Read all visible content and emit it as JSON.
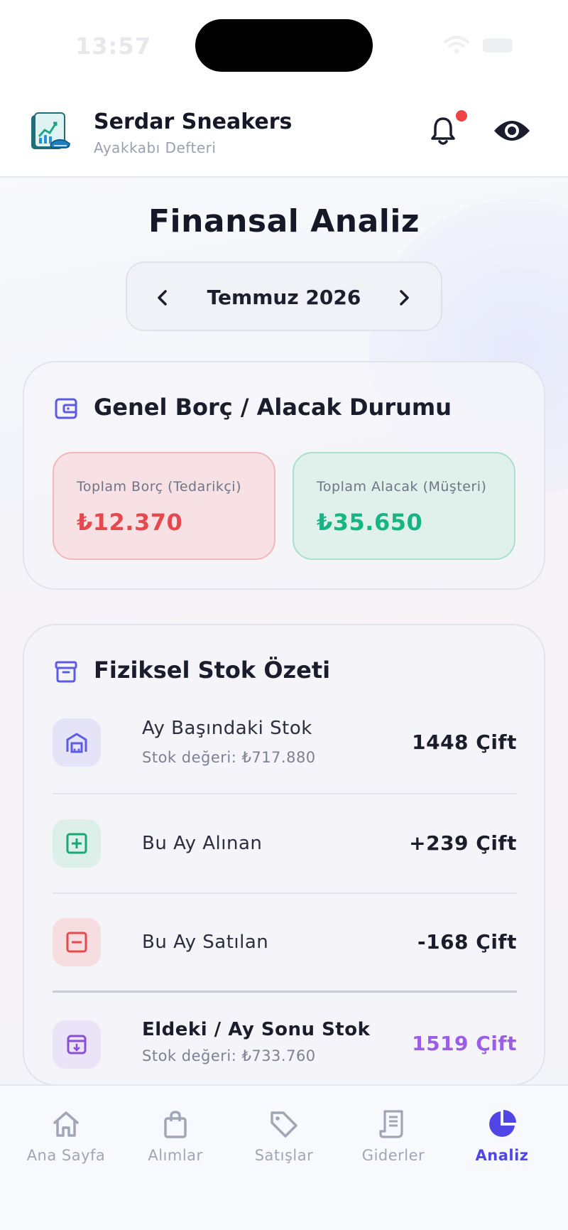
{
  "status_bar": {
    "time": "13:57"
  },
  "header": {
    "brand_name": "Serdar Sneakers",
    "brand_subtitle": "Ayakkabı Defteri",
    "notification_dot_color": "#ef4444"
  },
  "page": {
    "title": "Finansal Analiz",
    "month_label": "Temmuz 2026"
  },
  "debt_card": {
    "title": "Genel Borç / Alacak Durumu",
    "total_debt_label": "Toplam Borç (Tedarikçi)",
    "total_debt_value": "₺12.370",
    "total_receivable_label": "Toplam Alacak (Müşteri)",
    "total_receivable_value": "₺35.650"
  },
  "stock_card": {
    "title": "Fiziksel Stok Özeti",
    "rows": [
      {
        "title": "Ay Başındaki Stok",
        "subtitle": "Stok değeri: ₺717.880",
        "value": "1448 Çift",
        "icon": "warehouse-icon"
      },
      {
        "title": "Bu Ay Alınan",
        "subtitle": "",
        "value": "+239 Çift",
        "icon": "plus-square-icon"
      },
      {
        "title": "Bu Ay Satılan",
        "subtitle": "",
        "value": "-168 Çift",
        "icon": "minus-square-icon"
      },
      {
        "title": "Eldeki / Ay Sonu Stok",
        "subtitle": "Stok değeri: ₺733.760",
        "value": "1519 Çift",
        "icon": "archive-download-icon"
      }
    ]
  },
  "bottom_nav": {
    "items": [
      {
        "label": "Ana Sayfa",
        "icon": "home-icon",
        "active": false
      },
      {
        "label": "Alımlar",
        "icon": "shopping-bag-icon",
        "active": false
      },
      {
        "label": "Satışlar",
        "icon": "tag-icon",
        "active": false
      },
      {
        "label": "Giderler",
        "icon": "receipt-icon",
        "active": false
      },
      {
        "label": "Analiz",
        "icon": "pie-chart-icon",
        "active": true
      }
    ]
  },
  "colors": {
    "accent": "#4f46e5",
    "debt_red": "#e5484d",
    "receivable_green": "#17b582",
    "end_stock_purple": "#9b5de5"
  }
}
